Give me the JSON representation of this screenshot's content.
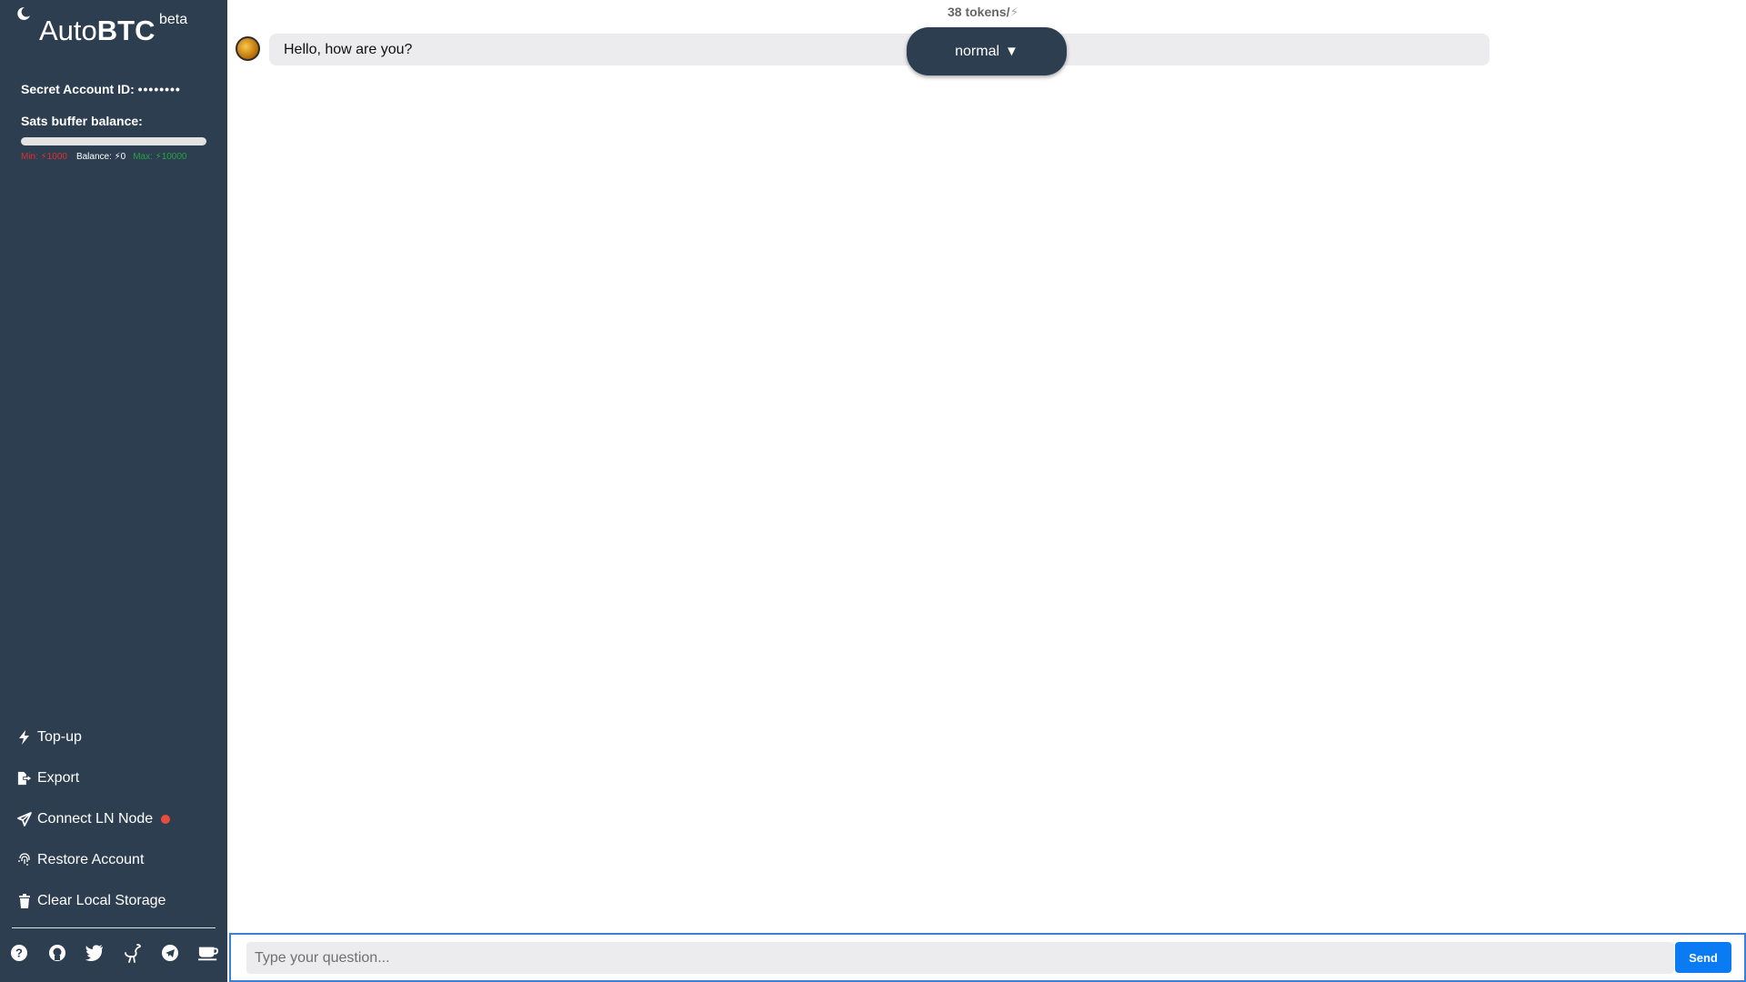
{
  "app": {
    "brand_prefix": "Auto",
    "brand_bold": "BTC",
    "badge": "beta"
  },
  "sidebar": {
    "theme_toggle_icon": "moon-icon",
    "account_label": "Secret Account ID:",
    "account_value": "••••••••",
    "sats_label": "Sats buffer balance:",
    "balance_fraction": 0,
    "legend": {
      "min": "Min: ⚡1000",
      "balance": "Balance: ⚡0",
      "max": "Max: ⚡10000"
    },
    "menu": [
      {
        "label": "Top-up",
        "icon": "bolt-icon"
      },
      {
        "label": "Export",
        "icon": "file-export-icon"
      },
      {
        "label": "Connect LN Node",
        "icon": "paper-plane-icon",
        "status": "disconnected"
      },
      {
        "label": "Restore Account",
        "icon": "fingerprint-icon"
      },
      {
        "label": "Clear Local Storage",
        "icon": "trash-icon"
      }
    ],
    "social": [
      "help-icon",
      "github-icon",
      "twitter-icon",
      "nostr-ostrich-icon",
      "telegram-icon",
      "coffee-icon"
    ]
  },
  "chat": {
    "tokens": "38 tokens/",
    "sat_symbol": "⚡",
    "messages": [
      {
        "text": "Hello, how are you?",
        "role": "assistant"
      }
    ],
    "mode_label": "normal",
    "mode_arrow": "▼"
  },
  "composer": {
    "placeholder": "Type your question...",
    "value": "",
    "send_label": "Send"
  },
  "colors": {
    "sidebar_bg": "#2d3e50",
    "send_bg": "#0a7bf2",
    "status_red": "#e74c3c",
    "min_red": "#e0302f",
    "max_green": "#25a244"
  }
}
